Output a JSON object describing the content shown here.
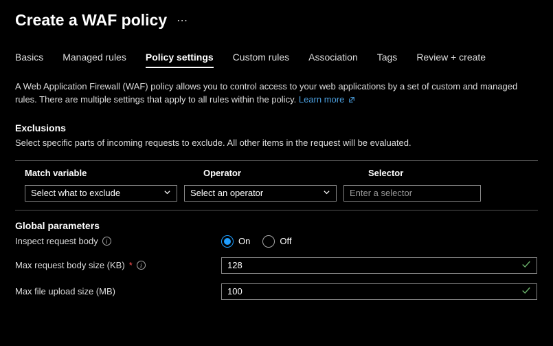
{
  "header": {
    "title": "Create a WAF policy"
  },
  "tabs": [
    {
      "id": "basics",
      "label": "Basics"
    },
    {
      "id": "managed-rules",
      "label": "Managed rules"
    },
    {
      "id": "policy-settings",
      "label": "Policy settings",
      "active": true
    },
    {
      "id": "custom-rules",
      "label": "Custom rules"
    },
    {
      "id": "association",
      "label": "Association"
    },
    {
      "id": "tags",
      "label": "Tags"
    },
    {
      "id": "review-create",
      "label": "Review + create"
    }
  ],
  "description": {
    "text": "A Web Application Firewall (WAF) policy allows you to control access to your web applications by a set of custom and managed rules. There are multiple settings that apply to all rules within the policy.",
    "learn_more": "Learn more"
  },
  "exclusions": {
    "title": "Exclusions",
    "subtitle": "Select specific parts of incoming requests to exclude. All other items in the request will be evaluated.",
    "columns": {
      "match_variable": "Match variable",
      "operator": "Operator",
      "selector": "Selector"
    },
    "row": {
      "match_variable_placeholder": "Select what to exclude",
      "operator_placeholder": "Select an operator",
      "selector_placeholder": "Enter a selector"
    }
  },
  "global": {
    "title": "Global parameters",
    "inspect_body": {
      "label": "Inspect request body",
      "value": "On",
      "options": {
        "on": "On",
        "off": "Off"
      }
    },
    "max_body": {
      "label": "Max request body size (KB)",
      "required": true,
      "value": "128"
    },
    "max_upload": {
      "label": "Max file upload size (MB)",
      "value": "100"
    }
  },
  "colors": {
    "link": "#4ca0e0",
    "accent": "#1f9eff",
    "success": "#6bb36b"
  }
}
